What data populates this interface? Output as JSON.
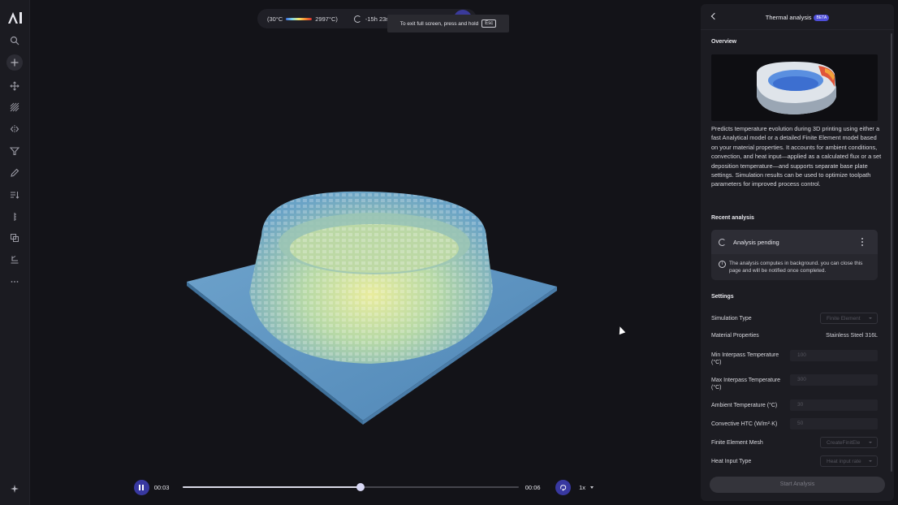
{
  "toolbar": {
    "tools": [
      "logo-icon",
      "search-icon",
      "add-icon",
      "move-icon",
      "hatch-icon",
      "mirror-icon",
      "filter-icon",
      "pencil-icon",
      "sort-icon",
      "ruler-icon",
      "layers-icon",
      "stamp-icon",
      "more-icon",
      "sparkle-icon"
    ]
  },
  "viewport": {
    "temp_min": "(30°C",
    "temp_max": "2997°C)",
    "eta": "-15h 23m",
    "fullscreen_hint": "To exit full screen, press and hold",
    "esc_key": "Esc"
  },
  "player": {
    "current_time": "00:03",
    "end_time": "00:06",
    "progress": 0.53,
    "speed": "1x"
  },
  "panel": {
    "title": "Thermal analysis",
    "badge": "BETA",
    "overview_heading": "Overview",
    "description": "Predicts temperature evolution during 3D printing using either a fast Analytical model or a detailed Finite Element model based on your material properties. It accounts for ambient conditions, convection, and heat input—applied as a calculated flux or a set deposition temperature—and supports separate base plate settings. Simulation results can be used to optimize toolpath parameters for improved process control.",
    "recent_heading": "Recent analysis",
    "analysis_status": "Analysis pending",
    "analysis_note": "The analysis computes in background. you can close this page and will be notified once completed.",
    "settings_heading": "Settings",
    "settings": {
      "simulation_type_label": "Simulation Type",
      "simulation_type_value": "Finite Element",
      "material_label": "Material Properties",
      "material_value": "Stainless Steel 316L",
      "min_interpass_label": "Min Interpass Temperature (°C)",
      "min_interpass_value": "100",
      "max_interpass_label": "Max Interpass Temperature (°C)",
      "max_interpass_value": "300",
      "ambient_label": "Ambient Temperature (°C)",
      "ambient_value": "30",
      "htc_label": "Convective HTC (W/m²·K)",
      "htc_value": "50",
      "mesh_label": "Finite Element Mesh",
      "mesh_value": "CreateFinitEle",
      "heat_input_label": "Heat Input Type",
      "heat_input_value": "Heat input rate"
    },
    "start_button": "Start Analysis"
  },
  "colors": {
    "accent": "#3838a0",
    "beta_badge": "#4e4ed8",
    "panel_bg": "#1c1c22",
    "plate": "#5f94c0"
  }
}
